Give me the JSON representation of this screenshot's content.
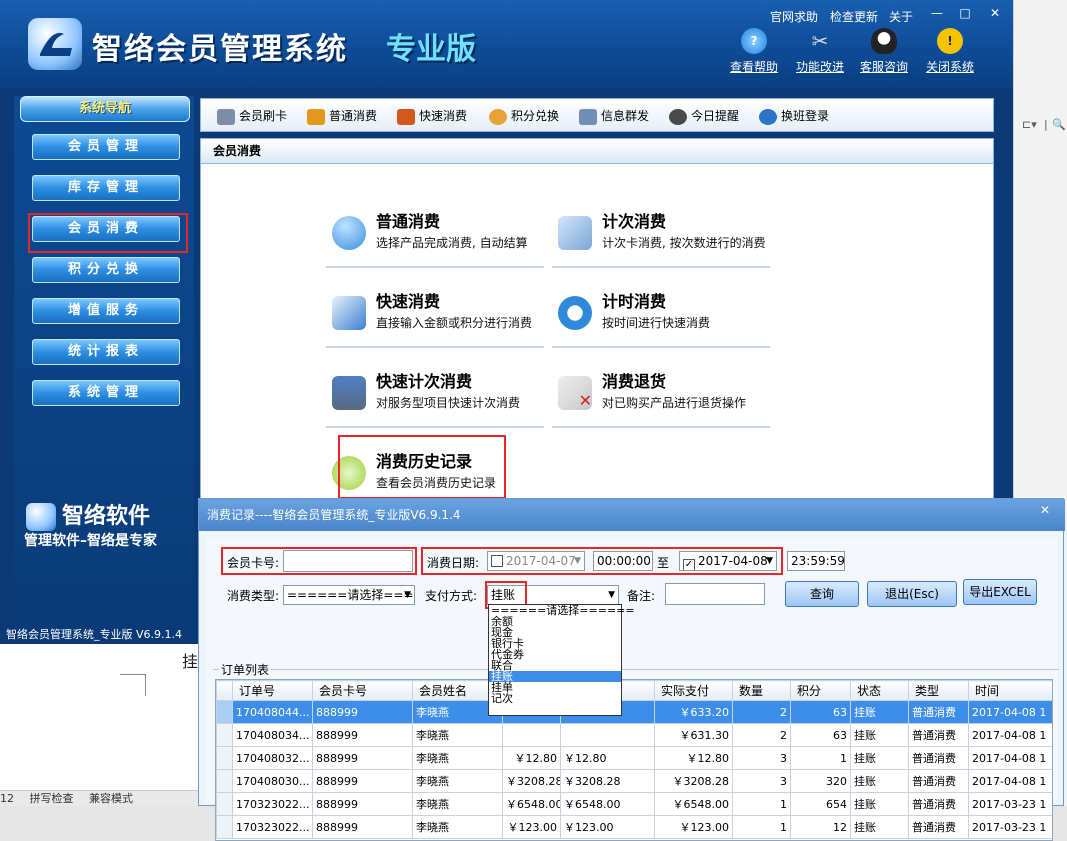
{
  "app": {
    "title": "智络会员管理系统",
    "edition": "专业版",
    "top_links": [
      "官网求助",
      "检查更新",
      "关于"
    ],
    "window_controls": [
      "—",
      "□",
      "✕"
    ],
    "tools": [
      {
        "label": "查看帮助",
        "icon": "help-icon",
        "color": "#1d7fe0"
      },
      {
        "label": "功能改进",
        "icon": "tools-icon",
        "color": "#8a8a8a"
      },
      {
        "label": "客服咨询",
        "icon": "qq-icon",
        "color": "#222222"
      },
      {
        "label": "关闭系统",
        "icon": "warning-icon",
        "color": "#f5c400"
      }
    ],
    "status_line": "智络会员管理系统_专业版 V6.9.1.4"
  },
  "sidebar": {
    "header": "系统导航",
    "items": [
      {
        "label": "会员管理"
      },
      {
        "label": "库存管理"
      },
      {
        "label": "会员消费"
      },
      {
        "label": "积分兑换"
      },
      {
        "label": "增值服务"
      },
      {
        "label": "统计报表"
      },
      {
        "label": "系统管理"
      }
    ],
    "brand": "智络软件",
    "slogan": "管理软件–智络是专家"
  },
  "toolbar": {
    "items": [
      {
        "label": "会员刷卡",
        "icon": "card-swipe-icon",
        "color": "#7d8fa8"
      },
      {
        "label": "普通消费",
        "icon": "money-bag-icon",
        "color": "#e39a1c"
      },
      {
        "label": "快速消费",
        "icon": "fast-consume-icon",
        "color": "#d4581c"
      },
      {
        "label": "积分兑换",
        "icon": "exchange-icon",
        "color": "#e7a23a"
      },
      {
        "label": "信息群发",
        "icon": "mail-icon",
        "color": "#6f8fb8"
      },
      {
        "label": "今日提醒",
        "icon": "clock-icon",
        "color": "#4a4a4a"
      },
      {
        "label": "换班登录",
        "icon": "shift-login-icon",
        "color": "#2b72c8"
      }
    ]
  },
  "section": {
    "title": "会员消费"
  },
  "functions": [
    {
      "title": "普通消费",
      "desc": "选择产品完成消费, 自动结算",
      "icon": "person-consume-icon",
      "color": "#3b8de0"
    },
    {
      "title": "计次消费",
      "desc": "计次卡消费, 按次数进行的消费",
      "icon": "count-card-icon",
      "color": "#7aa4d6"
    },
    {
      "title": "快速消费",
      "desc": "直接输入金额或积分进行消费",
      "icon": "quick-card-icon",
      "color": "#3a7fd0"
    },
    {
      "title": "计时消费",
      "desc": "按时间进行快速消费",
      "icon": "timer-icon",
      "color": "#2e8ad8"
    },
    {
      "title": "快速计次消费",
      "desc": "对服务型项目快速计次消费",
      "icon": "monitor-icon",
      "color": "#5a6a80"
    },
    {
      "title": "消费退货",
      "desc": "对已购买产品进行退货操作",
      "icon": "return-icon",
      "color": "#c8c8c8"
    },
    {
      "title": "消费历史记录",
      "desc": "查看会员消费历史记录",
      "icon": "history-icon",
      "color": "#9ccf3a"
    }
  ],
  "dialog": {
    "title": "消费记录----智络会员管理系统_专业版V6.9.1.4",
    "close": "✕",
    "card_label": "会员卡号:",
    "card_value": "",
    "date_label": "消费日期:",
    "date_from": "2017-04-07",
    "time_from": "00:00:00",
    "date_to_label": "至",
    "date_to": "2017-04-08",
    "time_to": "23:59:59",
    "type_label": "消费类型:",
    "type_value": "======请选择======",
    "pay_label": "支付方式:",
    "pay_value": "挂账",
    "note_label": "备注:",
    "note_value": "",
    "btn_query": "查询",
    "btn_exit": "退出(Esc)",
    "btn_export": "导出EXCEL",
    "list_label": "订单列表",
    "pay_options": [
      "======请选择======",
      "余额",
      "现金",
      "银行卡",
      "代金券",
      "联合",
      "挂账",
      "挂单",
      "记次"
    ],
    "pay_selected_index": 6,
    "columns": [
      "订单号",
      "会员卡号",
      "会员姓名",
      "",
      "",
      "实际支付",
      "数量",
      "积分",
      "状态",
      "类型",
      "时间"
    ],
    "rows": [
      [
        "170408044...",
        "888999",
        "李晓燕",
        "",
        "",
        "￥633.20",
        "2",
        "63",
        "挂账",
        "普通消费",
        "2017-04-08 1"
      ],
      [
        "170408034...",
        "888999",
        "李晓燕",
        "",
        "",
        "￥631.30",
        "2",
        "63",
        "挂账",
        "普通消费",
        "2017-04-08 1"
      ],
      [
        "170408032...",
        "888999",
        "李晓燕",
        "￥12.80",
        "￥12.80",
        "￥12.80",
        "3",
        "1",
        "挂账",
        "普通消费",
        "2017-04-08 1"
      ],
      [
        "170408030...",
        "888999",
        "李晓燕",
        "￥3208.28",
        "￥3208.28",
        "￥3208.28",
        "3",
        "320",
        "挂账",
        "普通消费",
        "2017-04-08 1"
      ],
      [
        "170323022...",
        "888999",
        "李晓燕",
        "￥6548.00",
        "￥6548.00",
        "￥6548.00",
        "1",
        "654",
        "挂账",
        "普通消费",
        "2017-03-23 1"
      ],
      [
        "170323022...",
        "888999",
        "李晓燕",
        "￥123.00",
        "￥123.00",
        "￥123.00",
        "1",
        "12",
        "挂账",
        "普通消费",
        "2017-03-23 1"
      ]
    ]
  },
  "host": {
    "doc_char": "挂",
    "status_items": [
      "12",
      "拼写检查",
      "兼容模式"
    ],
    "right_tools": [
      "⊏▾",
      "|",
      "🔍"
    ]
  }
}
